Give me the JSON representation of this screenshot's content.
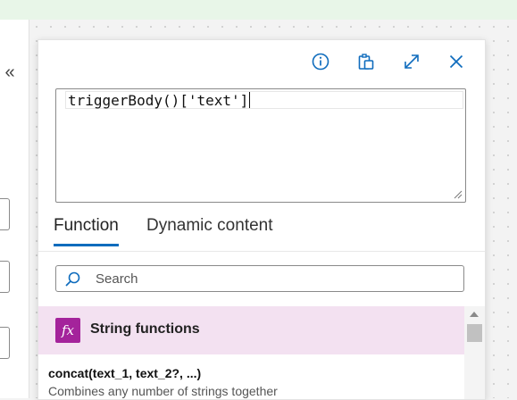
{
  "expression": {
    "value": "triggerBody()['text']"
  },
  "header": {
    "icons": [
      "info-icon",
      "clipboard-icon",
      "expand-icon",
      "close-icon"
    ]
  },
  "tabs": [
    {
      "label": "Function",
      "active": true
    },
    {
      "label": "Dynamic content",
      "active": false
    }
  ],
  "search": {
    "placeholder": "Search",
    "value": ""
  },
  "category": {
    "icon": "fx",
    "label": "String functions",
    "color": "#a4239b",
    "background": "#f3e1f1"
  },
  "functions": [
    {
      "name": "concat(text_1, text_2?, ...)",
      "description": "Combines any number of strings together"
    }
  ],
  "colors": {
    "accent": "#0f6cbd",
    "topbar": "#e8f6e8"
  }
}
